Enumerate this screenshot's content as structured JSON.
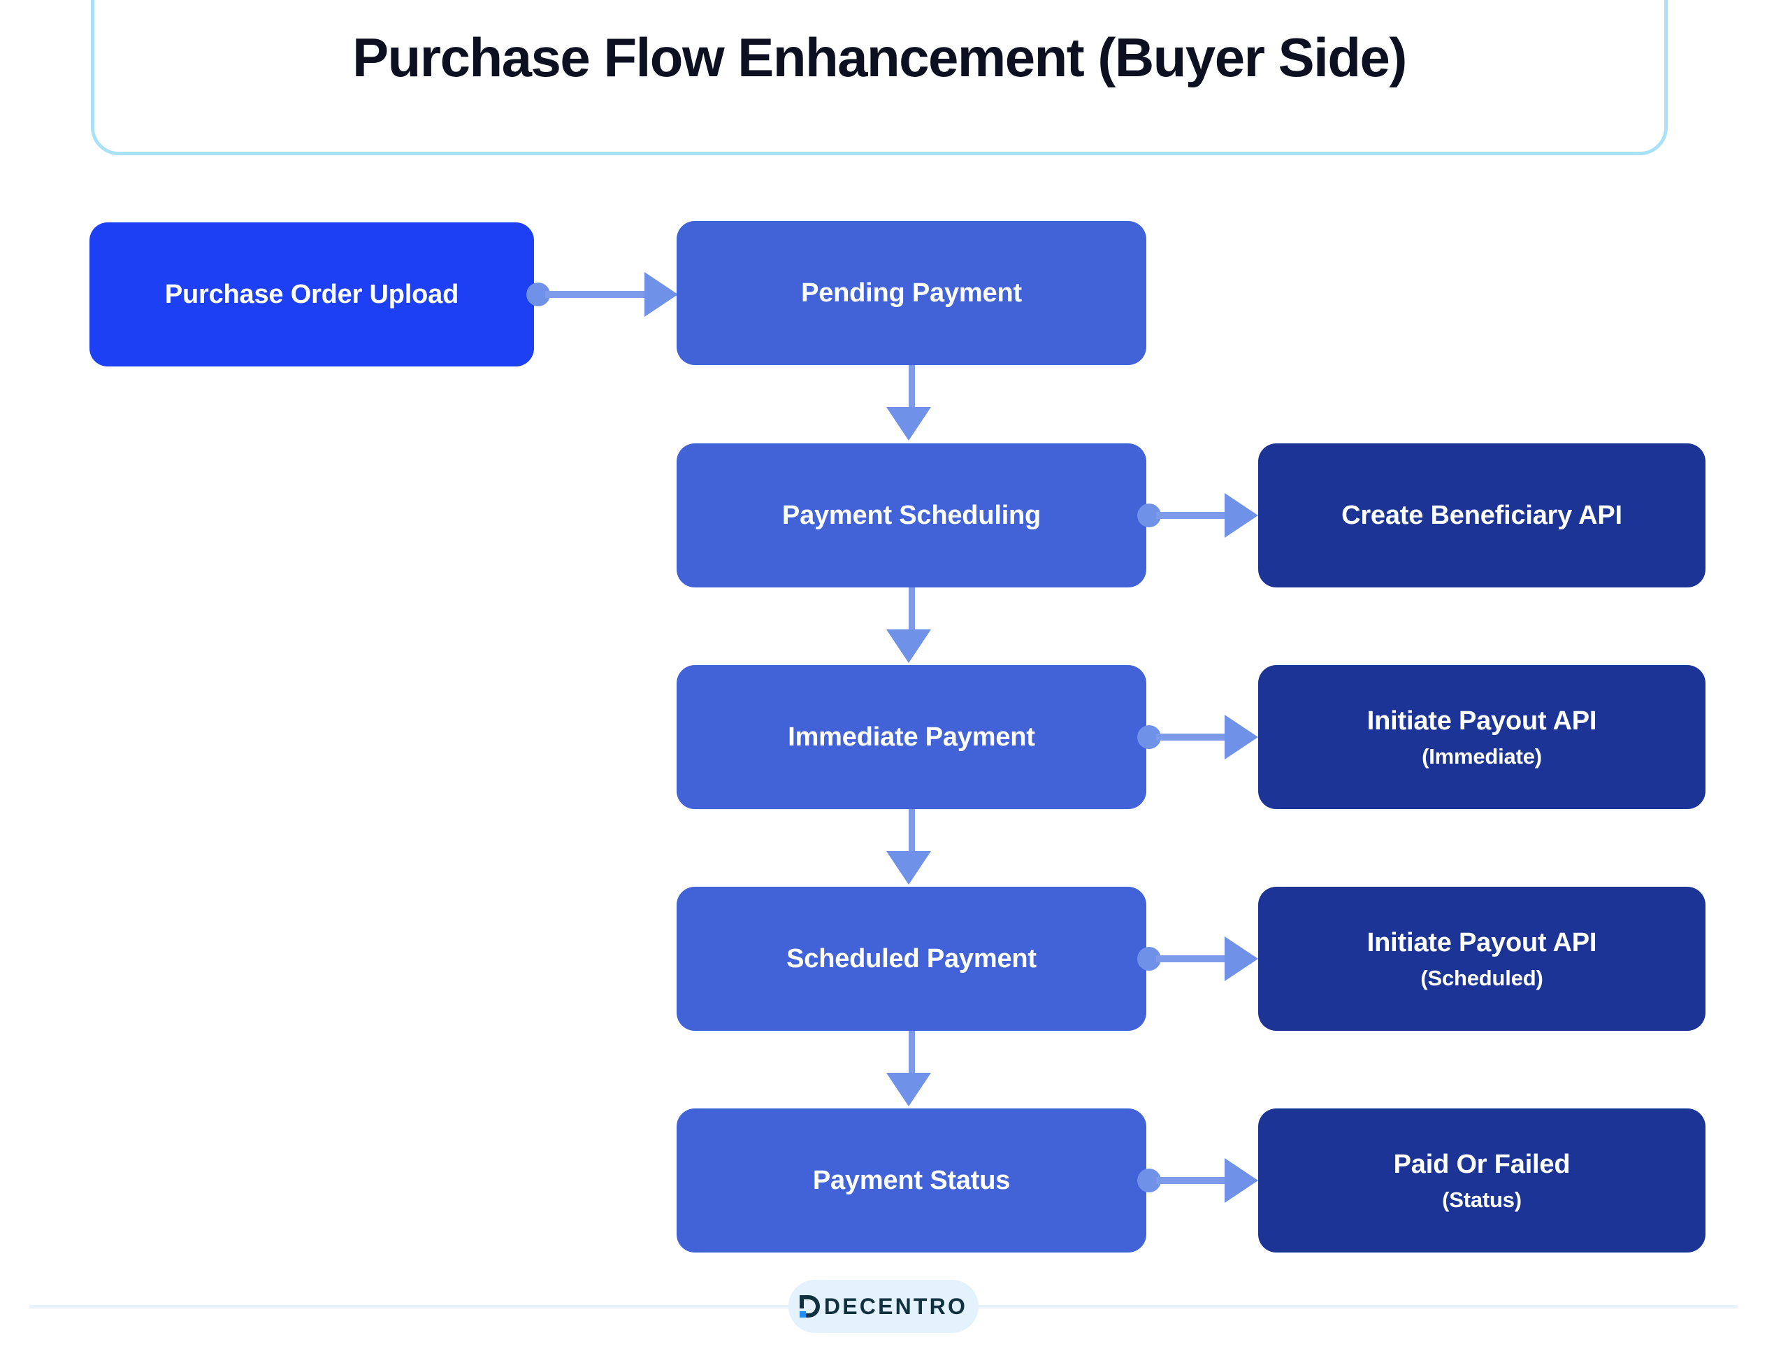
{
  "header": {
    "title": "Purchase Flow Enhancement (Buyer Side)"
  },
  "colors": {
    "start_node": "#1d40f5",
    "stage_node": "#4263d8",
    "api_node": "#1b3496",
    "connector": "#6f91e7",
    "card_border": "#a9e2f8",
    "footer_pill": "#e4f2fd",
    "logo_text": "#11313f",
    "logo_accent": "#1d8ef5"
  },
  "diagram": {
    "type": "flowchart",
    "start": {
      "label": "Purchase Order Upload"
    },
    "stages": [
      {
        "label": "Pending Payment"
      },
      {
        "label": "Payment Scheduling"
      },
      {
        "label": "Immediate Payment"
      },
      {
        "label": "Scheduled Payment"
      },
      {
        "label": "Payment Status"
      }
    ],
    "apis": [
      {
        "label": "Create Beneficiary API",
        "sub": ""
      },
      {
        "label": "Initiate Payout API",
        "sub": "(Immediate)"
      },
      {
        "label": "Initiate Payout API",
        "sub": "(Scheduled)"
      },
      {
        "label": "Paid Or Failed",
        "sub": "(Status)"
      }
    ],
    "edges": [
      {
        "from": "Purchase Order Upload",
        "to": "Pending Payment",
        "direction": "right"
      },
      {
        "from": "Pending Payment",
        "to": "Payment Scheduling",
        "direction": "down"
      },
      {
        "from": "Payment Scheduling",
        "to": "Create Beneficiary API",
        "direction": "right"
      },
      {
        "from": "Payment Scheduling",
        "to": "Immediate Payment",
        "direction": "down"
      },
      {
        "from": "Immediate Payment",
        "to": "Initiate Payout API (Immediate)",
        "direction": "right"
      },
      {
        "from": "Immediate Payment",
        "to": "Scheduled Payment",
        "direction": "down"
      },
      {
        "from": "Scheduled Payment",
        "to": "Initiate Payout API (Scheduled)",
        "direction": "right"
      },
      {
        "from": "Scheduled Payment",
        "to": "Payment Status",
        "direction": "down"
      },
      {
        "from": "Payment Status",
        "to": "Paid Or Failed (Status)",
        "direction": "right"
      }
    ]
  },
  "footer": {
    "logo_text": "DECENTRO"
  }
}
